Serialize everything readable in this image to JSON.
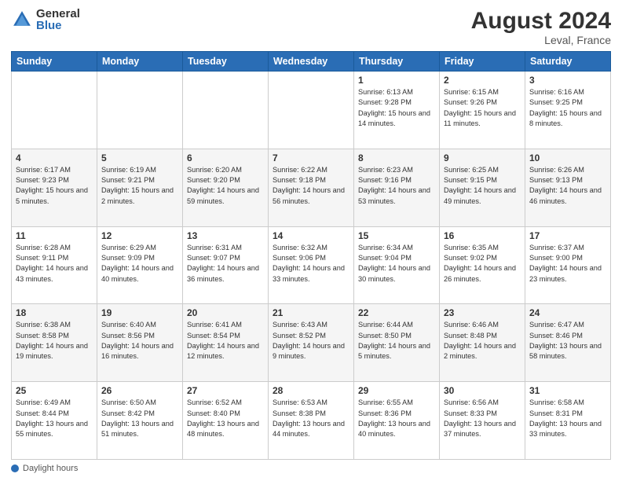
{
  "header": {
    "logo_general": "General",
    "logo_blue": "Blue",
    "month_year": "August 2024",
    "location": "Leval, France"
  },
  "days_of_week": [
    "Sunday",
    "Monday",
    "Tuesday",
    "Wednesday",
    "Thursday",
    "Friday",
    "Saturday"
  ],
  "legend": {
    "daylight_label": "Daylight hours"
  },
  "weeks": [
    [
      {
        "day": "",
        "info": ""
      },
      {
        "day": "",
        "info": ""
      },
      {
        "day": "",
        "info": ""
      },
      {
        "day": "",
        "info": ""
      },
      {
        "day": "1",
        "info": "Sunrise: 6:13 AM\nSunset: 9:28 PM\nDaylight: 15 hours\nand 14 minutes."
      },
      {
        "day": "2",
        "info": "Sunrise: 6:15 AM\nSunset: 9:26 PM\nDaylight: 15 hours\nand 11 minutes."
      },
      {
        "day": "3",
        "info": "Sunrise: 6:16 AM\nSunset: 9:25 PM\nDaylight: 15 hours\nand 8 minutes."
      }
    ],
    [
      {
        "day": "4",
        "info": "Sunrise: 6:17 AM\nSunset: 9:23 PM\nDaylight: 15 hours\nand 5 minutes."
      },
      {
        "day": "5",
        "info": "Sunrise: 6:19 AM\nSunset: 9:21 PM\nDaylight: 15 hours\nand 2 minutes."
      },
      {
        "day": "6",
        "info": "Sunrise: 6:20 AM\nSunset: 9:20 PM\nDaylight: 14 hours\nand 59 minutes."
      },
      {
        "day": "7",
        "info": "Sunrise: 6:22 AM\nSunset: 9:18 PM\nDaylight: 14 hours\nand 56 minutes."
      },
      {
        "day": "8",
        "info": "Sunrise: 6:23 AM\nSunset: 9:16 PM\nDaylight: 14 hours\nand 53 minutes."
      },
      {
        "day": "9",
        "info": "Sunrise: 6:25 AM\nSunset: 9:15 PM\nDaylight: 14 hours\nand 49 minutes."
      },
      {
        "day": "10",
        "info": "Sunrise: 6:26 AM\nSunset: 9:13 PM\nDaylight: 14 hours\nand 46 minutes."
      }
    ],
    [
      {
        "day": "11",
        "info": "Sunrise: 6:28 AM\nSunset: 9:11 PM\nDaylight: 14 hours\nand 43 minutes."
      },
      {
        "day": "12",
        "info": "Sunrise: 6:29 AM\nSunset: 9:09 PM\nDaylight: 14 hours\nand 40 minutes."
      },
      {
        "day": "13",
        "info": "Sunrise: 6:31 AM\nSunset: 9:07 PM\nDaylight: 14 hours\nand 36 minutes."
      },
      {
        "day": "14",
        "info": "Sunrise: 6:32 AM\nSunset: 9:06 PM\nDaylight: 14 hours\nand 33 minutes."
      },
      {
        "day": "15",
        "info": "Sunrise: 6:34 AM\nSunset: 9:04 PM\nDaylight: 14 hours\nand 30 minutes."
      },
      {
        "day": "16",
        "info": "Sunrise: 6:35 AM\nSunset: 9:02 PM\nDaylight: 14 hours\nand 26 minutes."
      },
      {
        "day": "17",
        "info": "Sunrise: 6:37 AM\nSunset: 9:00 PM\nDaylight: 14 hours\nand 23 minutes."
      }
    ],
    [
      {
        "day": "18",
        "info": "Sunrise: 6:38 AM\nSunset: 8:58 PM\nDaylight: 14 hours\nand 19 minutes."
      },
      {
        "day": "19",
        "info": "Sunrise: 6:40 AM\nSunset: 8:56 PM\nDaylight: 14 hours\nand 16 minutes."
      },
      {
        "day": "20",
        "info": "Sunrise: 6:41 AM\nSunset: 8:54 PM\nDaylight: 14 hours\nand 12 minutes."
      },
      {
        "day": "21",
        "info": "Sunrise: 6:43 AM\nSunset: 8:52 PM\nDaylight: 14 hours\nand 9 minutes."
      },
      {
        "day": "22",
        "info": "Sunrise: 6:44 AM\nSunset: 8:50 PM\nDaylight: 14 hours\nand 5 minutes."
      },
      {
        "day": "23",
        "info": "Sunrise: 6:46 AM\nSunset: 8:48 PM\nDaylight: 14 hours\nand 2 minutes."
      },
      {
        "day": "24",
        "info": "Sunrise: 6:47 AM\nSunset: 8:46 PM\nDaylight: 13 hours\nand 58 minutes."
      }
    ],
    [
      {
        "day": "25",
        "info": "Sunrise: 6:49 AM\nSunset: 8:44 PM\nDaylight: 13 hours\nand 55 minutes."
      },
      {
        "day": "26",
        "info": "Sunrise: 6:50 AM\nSunset: 8:42 PM\nDaylight: 13 hours\nand 51 minutes."
      },
      {
        "day": "27",
        "info": "Sunrise: 6:52 AM\nSunset: 8:40 PM\nDaylight: 13 hours\nand 48 minutes."
      },
      {
        "day": "28",
        "info": "Sunrise: 6:53 AM\nSunset: 8:38 PM\nDaylight: 13 hours\nand 44 minutes."
      },
      {
        "day": "29",
        "info": "Sunrise: 6:55 AM\nSunset: 8:36 PM\nDaylight: 13 hours\nand 40 minutes."
      },
      {
        "day": "30",
        "info": "Sunrise: 6:56 AM\nSunset: 8:33 PM\nDaylight: 13 hours\nand 37 minutes."
      },
      {
        "day": "31",
        "info": "Sunrise: 6:58 AM\nSunset: 8:31 PM\nDaylight: 13 hours\nand 33 minutes."
      }
    ]
  ]
}
